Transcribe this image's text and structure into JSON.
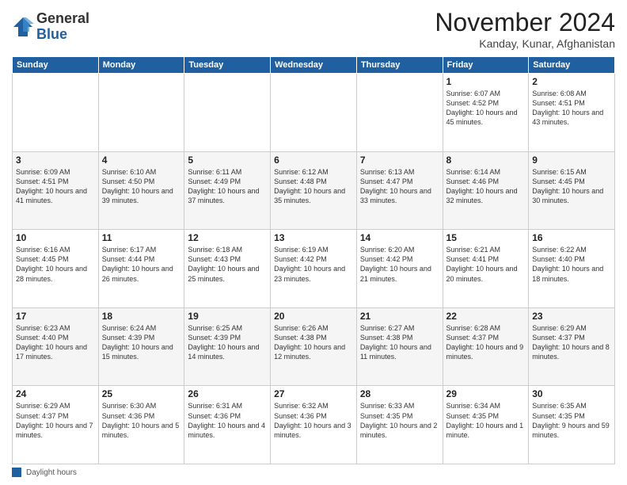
{
  "logo": {
    "general": "General",
    "blue": "Blue"
  },
  "header": {
    "month": "November 2024",
    "location": "Kanday, Kunar, Afghanistan"
  },
  "days_of_week": [
    "Sunday",
    "Monday",
    "Tuesday",
    "Wednesday",
    "Thursday",
    "Friday",
    "Saturday"
  ],
  "footer": {
    "daylight_label": "Daylight hours"
  },
  "weeks": [
    [
      {
        "day": "",
        "info": ""
      },
      {
        "day": "",
        "info": ""
      },
      {
        "day": "",
        "info": ""
      },
      {
        "day": "",
        "info": ""
      },
      {
        "day": "",
        "info": ""
      },
      {
        "day": "1",
        "info": "Sunrise: 6:07 AM\nSunset: 4:52 PM\nDaylight: 10 hours\nand 45 minutes."
      },
      {
        "day": "2",
        "info": "Sunrise: 6:08 AM\nSunset: 4:51 PM\nDaylight: 10 hours\nand 43 minutes."
      }
    ],
    [
      {
        "day": "3",
        "info": "Sunrise: 6:09 AM\nSunset: 4:51 PM\nDaylight: 10 hours\nand 41 minutes."
      },
      {
        "day": "4",
        "info": "Sunrise: 6:10 AM\nSunset: 4:50 PM\nDaylight: 10 hours\nand 39 minutes."
      },
      {
        "day": "5",
        "info": "Sunrise: 6:11 AM\nSunset: 4:49 PM\nDaylight: 10 hours\nand 37 minutes."
      },
      {
        "day": "6",
        "info": "Sunrise: 6:12 AM\nSunset: 4:48 PM\nDaylight: 10 hours\nand 35 minutes."
      },
      {
        "day": "7",
        "info": "Sunrise: 6:13 AM\nSunset: 4:47 PM\nDaylight: 10 hours\nand 33 minutes."
      },
      {
        "day": "8",
        "info": "Sunrise: 6:14 AM\nSunset: 4:46 PM\nDaylight: 10 hours\nand 32 minutes."
      },
      {
        "day": "9",
        "info": "Sunrise: 6:15 AM\nSunset: 4:45 PM\nDaylight: 10 hours\nand 30 minutes."
      }
    ],
    [
      {
        "day": "10",
        "info": "Sunrise: 6:16 AM\nSunset: 4:45 PM\nDaylight: 10 hours\nand 28 minutes."
      },
      {
        "day": "11",
        "info": "Sunrise: 6:17 AM\nSunset: 4:44 PM\nDaylight: 10 hours\nand 26 minutes."
      },
      {
        "day": "12",
        "info": "Sunrise: 6:18 AM\nSunset: 4:43 PM\nDaylight: 10 hours\nand 25 minutes."
      },
      {
        "day": "13",
        "info": "Sunrise: 6:19 AM\nSunset: 4:42 PM\nDaylight: 10 hours\nand 23 minutes."
      },
      {
        "day": "14",
        "info": "Sunrise: 6:20 AM\nSunset: 4:42 PM\nDaylight: 10 hours\nand 21 minutes."
      },
      {
        "day": "15",
        "info": "Sunrise: 6:21 AM\nSunset: 4:41 PM\nDaylight: 10 hours\nand 20 minutes."
      },
      {
        "day": "16",
        "info": "Sunrise: 6:22 AM\nSunset: 4:40 PM\nDaylight: 10 hours\nand 18 minutes."
      }
    ],
    [
      {
        "day": "17",
        "info": "Sunrise: 6:23 AM\nSunset: 4:40 PM\nDaylight: 10 hours\nand 17 minutes."
      },
      {
        "day": "18",
        "info": "Sunrise: 6:24 AM\nSunset: 4:39 PM\nDaylight: 10 hours\nand 15 minutes."
      },
      {
        "day": "19",
        "info": "Sunrise: 6:25 AM\nSunset: 4:39 PM\nDaylight: 10 hours\nand 14 minutes."
      },
      {
        "day": "20",
        "info": "Sunrise: 6:26 AM\nSunset: 4:38 PM\nDaylight: 10 hours\nand 12 minutes."
      },
      {
        "day": "21",
        "info": "Sunrise: 6:27 AM\nSunset: 4:38 PM\nDaylight: 10 hours\nand 11 minutes."
      },
      {
        "day": "22",
        "info": "Sunrise: 6:28 AM\nSunset: 4:37 PM\nDaylight: 10 hours\nand 9 minutes."
      },
      {
        "day": "23",
        "info": "Sunrise: 6:29 AM\nSunset: 4:37 PM\nDaylight: 10 hours\nand 8 minutes."
      }
    ],
    [
      {
        "day": "24",
        "info": "Sunrise: 6:29 AM\nSunset: 4:37 PM\nDaylight: 10 hours\nand 7 minutes."
      },
      {
        "day": "25",
        "info": "Sunrise: 6:30 AM\nSunset: 4:36 PM\nDaylight: 10 hours\nand 5 minutes."
      },
      {
        "day": "26",
        "info": "Sunrise: 6:31 AM\nSunset: 4:36 PM\nDaylight: 10 hours\nand 4 minutes."
      },
      {
        "day": "27",
        "info": "Sunrise: 6:32 AM\nSunset: 4:36 PM\nDaylight: 10 hours\nand 3 minutes."
      },
      {
        "day": "28",
        "info": "Sunrise: 6:33 AM\nSunset: 4:35 PM\nDaylight: 10 hours\nand 2 minutes."
      },
      {
        "day": "29",
        "info": "Sunrise: 6:34 AM\nSunset: 4:35 PM\nDaylight: 10 hours\nand 1 minute."
      },
      {
        "day": "30",
        "info": "Sunrise: 6:35 AM\nSunset: 4:35 PM\nDaylight: 9 hours\nand 59 minutes."
      }
    ]
  ]
}
